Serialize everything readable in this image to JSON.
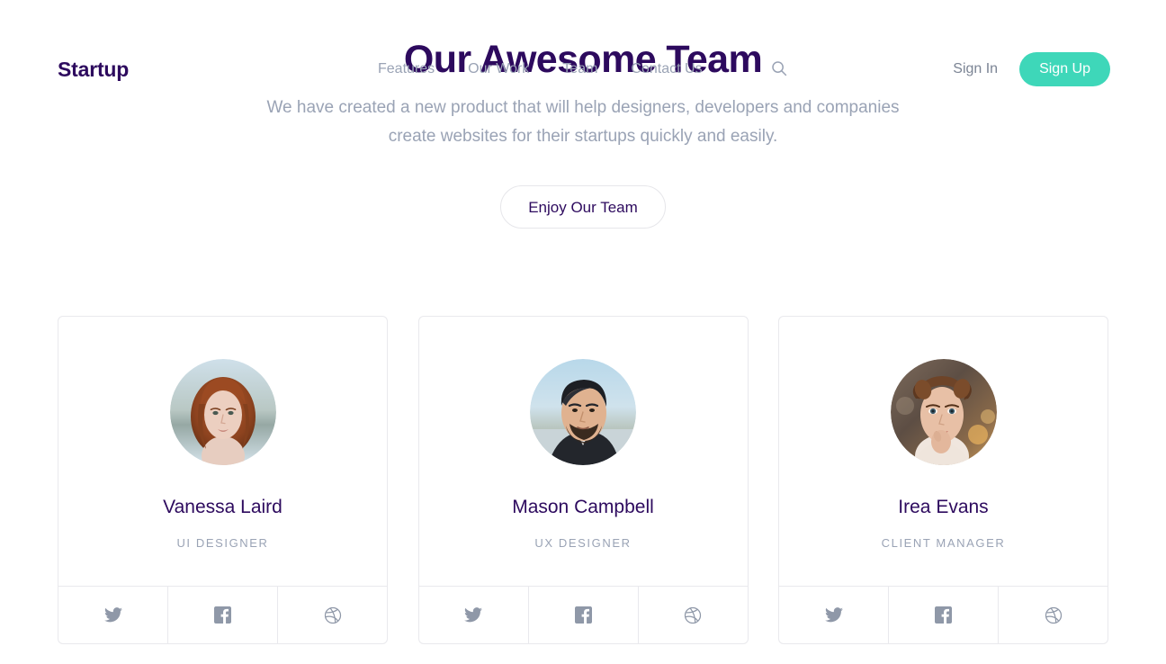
{
  "header": {
    "brand": "Startup",
    "nav": [
      {
        "label": "Features",
        "name": "nav-features"
      },
      {
        "label": "Our Work",
        "name": "nav-our-work"
      },
      {
        "label": "Team",
        "name": "nav-team"
      },
      {
        "label": "Contact Us",
        "name": "nav-contact-us"
      }
    ],
    "search_icon": "search-icon",
    "sign_in_label": "Sign In",
    "sign_up_label": "Sign Up",
    "accent_color": "#3ed7b9",
    "brand_color": "#2d0a5e",
    "nav_text_color": "#9aa3b5"
  },
  "hero": {
    "title": "Our Awesome Team",
    "subtitle": "We have created a new product that will help designers, developers and companies create websites for their startups quickly and easily.",
    "cta_label": "Enjoy Our Team"
  },
  "team": {
    "members": [
      {
        "name": "Vanessa Laird",
        "role": "UI DESIGNER",
        "avatar": "portrait-woman-auburn-hair",
        "socials": [
          {
            "icon": "twitter-icon",
            "label": "Twitter"
          },
          {
            "icon": "facebook-icon",
            "label": "Facebook"
          },
          {
            "icon": "dribbble-icon",
            "label": "Dribbble"
          }
        ]
      },
      {
        "name": "Mason Campbell",
        "role": "UX DESIGNER",
        "avatar": "portrait-man-dark-hair",
        "socials": [
          {
            "icon": "twitter-icon",
            "label": "Twitter"
          },
          {
            "icon": "facebook-icon",
            "label": "Facebook"
          },
          {
            "icon": "dribbble-icon",
            "label": "Dribbble"
          }
        ]
      },
      {
        "name": "Irea Evans",
        "role": "CLIENT MANAGER",
        "avatar": "portrait-woman-updo",
        "socials": [
          {
            "icon": "twitter-icon",
            "label": "Twitter"
          },
          {
            "icon": "facebook-icon",
            "label": "Facebook"
          },
          {
            "icon": "dribbble-icon",
            "label": "Dribbble"
          }
        ]
      }
    ]
  }
}
